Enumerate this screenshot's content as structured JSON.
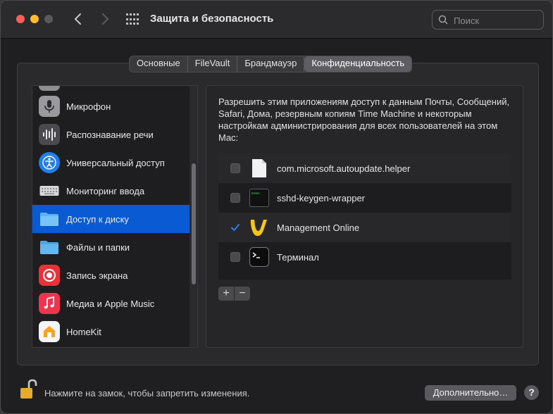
{
  "window": {
    "title": "Защита и безопасность",
    "search_placeholder": "Поиск"
  },
  "tabs": [
    {
      "label": "Основные"
    },
    {
      "label": "FileVault"
    },
    {
      "label": "Брандмауэр"
    },
    {
      "label": "Конфиденциальность",
      "active": true
    }
  ],
  "sidebar": {
    "items": [
      {
        "label": "Микрофон",
        "icon": "microphone-icon"
      },
      {
        "label": "Распознавание речи",
        "icon": "speech-recognition-icon"
      },
      {
        "label": "Универсальный доступ",
        "icon": "accessibility-icon"
      },
      {
        "label": "Мониторинг ввода",
        "icon": "keyboard-icon"
      },
      {
        "label": "Доступ к диску",
        "icon": "folder-icon",
        "selected": true
      },
      {
        "label": "Файлы и папки",
        "icon": "folder-icon"
      },
      {
        "label": "Запись экрана",
        "icon": "screen-record-icon"
      },
      {
        "label": "Медиа и Apple Music",
        "icon": "music-note-icon"
      },
      {
        "label": "HomeKit",
        "icon": "home-icon"
      }
    ]
  },
  "main": {
    "description": "Разрешить этим приложениям доступ к данным Почты, Сообщений, Safari, Дома, резервным копиям Time Machine и некоторым настройкам администрирования для всех пользователей на этом Mac:",
    "apps": [
      {
        "label": "com.microsoft.autoupdate.helper",
        "checked": false,
        "icon": "document-icon"
      },
      {
        "label": "sshd-keygen-wrapper",
        "checked": false,
        "icon": "terminal-exec-icon"
      },
      {
        "label": "Management Online",
        "checked": true,
        "icon": "management-online-icon"
      },
      {
        "label": "Терминал",
        "checked": false,
        "icon": "terminal-icon"
      }
    ],
    "plus_label": "+",
    "minus_label": "−"
  },
  "footer": {
    "lock_text": "Нажмите на замок, чтобы запретить изменения.",
    "advanced_label": "Дополнительно…",
    "help_label": "?"
  },
  "colors": {
    "accent": "#0a5bd3",
    "checkbox_checked": "#2f7bf5"
  }
}
